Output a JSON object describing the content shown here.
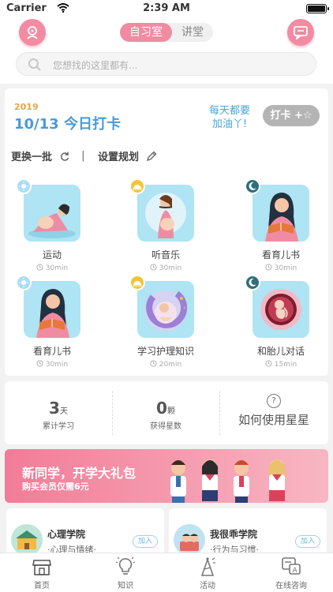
{
  "status_bar": {
    "carrier": "Carrier",
    "time": "2:39 AM"
  },
  "header": {
    "tabs": [
      {
        "label": "自习室",
        "active": true
      },
      {
        "label": "讲堂",
        "active": false
      }
    ],
    "search_placeholder": "您想找的这里都有..."
  },
  "checkin": {
    "year": "2019",
    "date": "10/13 今日打卡",
    "encourage": "每天都要加油丫!",
    "button": "打卡 +☆",
    "refresh_label": "更换一批",
    "divider": "|",
    "plan_label": "设置规划"
  },
  "activities": [
    {
      "name": "运动",
      "duration": "30min",
      "time_of_day": "morning",
      "badge_color": "#a9ddf5"
    },
    {
      "name": "听音乐",
      "duration": "30min",
      "time_of_day": "noon",
      "badge_color": "#f2c437"
    },
    {
      "name": "看育儿书",
      "duration": "30min",
      "time_of_day": "night",
      "badge_color": "#2f6d7a"
    },
    {
      "name": "看育儿书",
      "duration": "30min",
      "time_of_day": "morning",
      "badge_color": "#a9ddf5"
    },
    {
      "name": "学习护理知识",
      "duration": "20min",
      "time_of_day": "noon",
      "badge_color": "#f2c437"
    },
    {
      "name": "和胎儿对话",
      "duration": "15min",
      "time_of_day": "night",
      "badge_color": "#2f6d7a"
    }
  ],
  "stats": {
    "study_days": {
      "value": "3",
      "unit": "天",
      "label": "累计学习"
    },
    "stars": {
      "value": "0",
      "unit": "颗",
      "label": "获得星数"
    },
    "help_label": "如何使用星星",
    "help_icon": "?"
  },
  "banner": {
    "title": "新同学，开学大礼包",
    "subtitle": "购买会员仅需6元"
  },
  "courses": [
    {
      "name": "心理学院",
      "desc": "·心理与情绪·",
      "join": "加入"
    },
    {
      "name": "我很乖学院",
      "desc": "·行为与习惯·",
      "join": "加入"
    }
  ],
  "tabbar": [
    {
      "label": "首页",
      "icon": "home-store-icon"
    },
    {
      "label": "知识",
      "icon": "lightbulb-icon"
    },
    {
      "label": "活动",
      "icon": "party-hat-icon"
    },
    {
      "label": "在线咨询",
      "icon": "chat-consult-icon"
    }
  ],
  "colors": {
    "accent_pink": "#f08ca2",
    "accent_blue": "#4a9ad8",
    "tile_bg": "#aee4f3"
  }
}
